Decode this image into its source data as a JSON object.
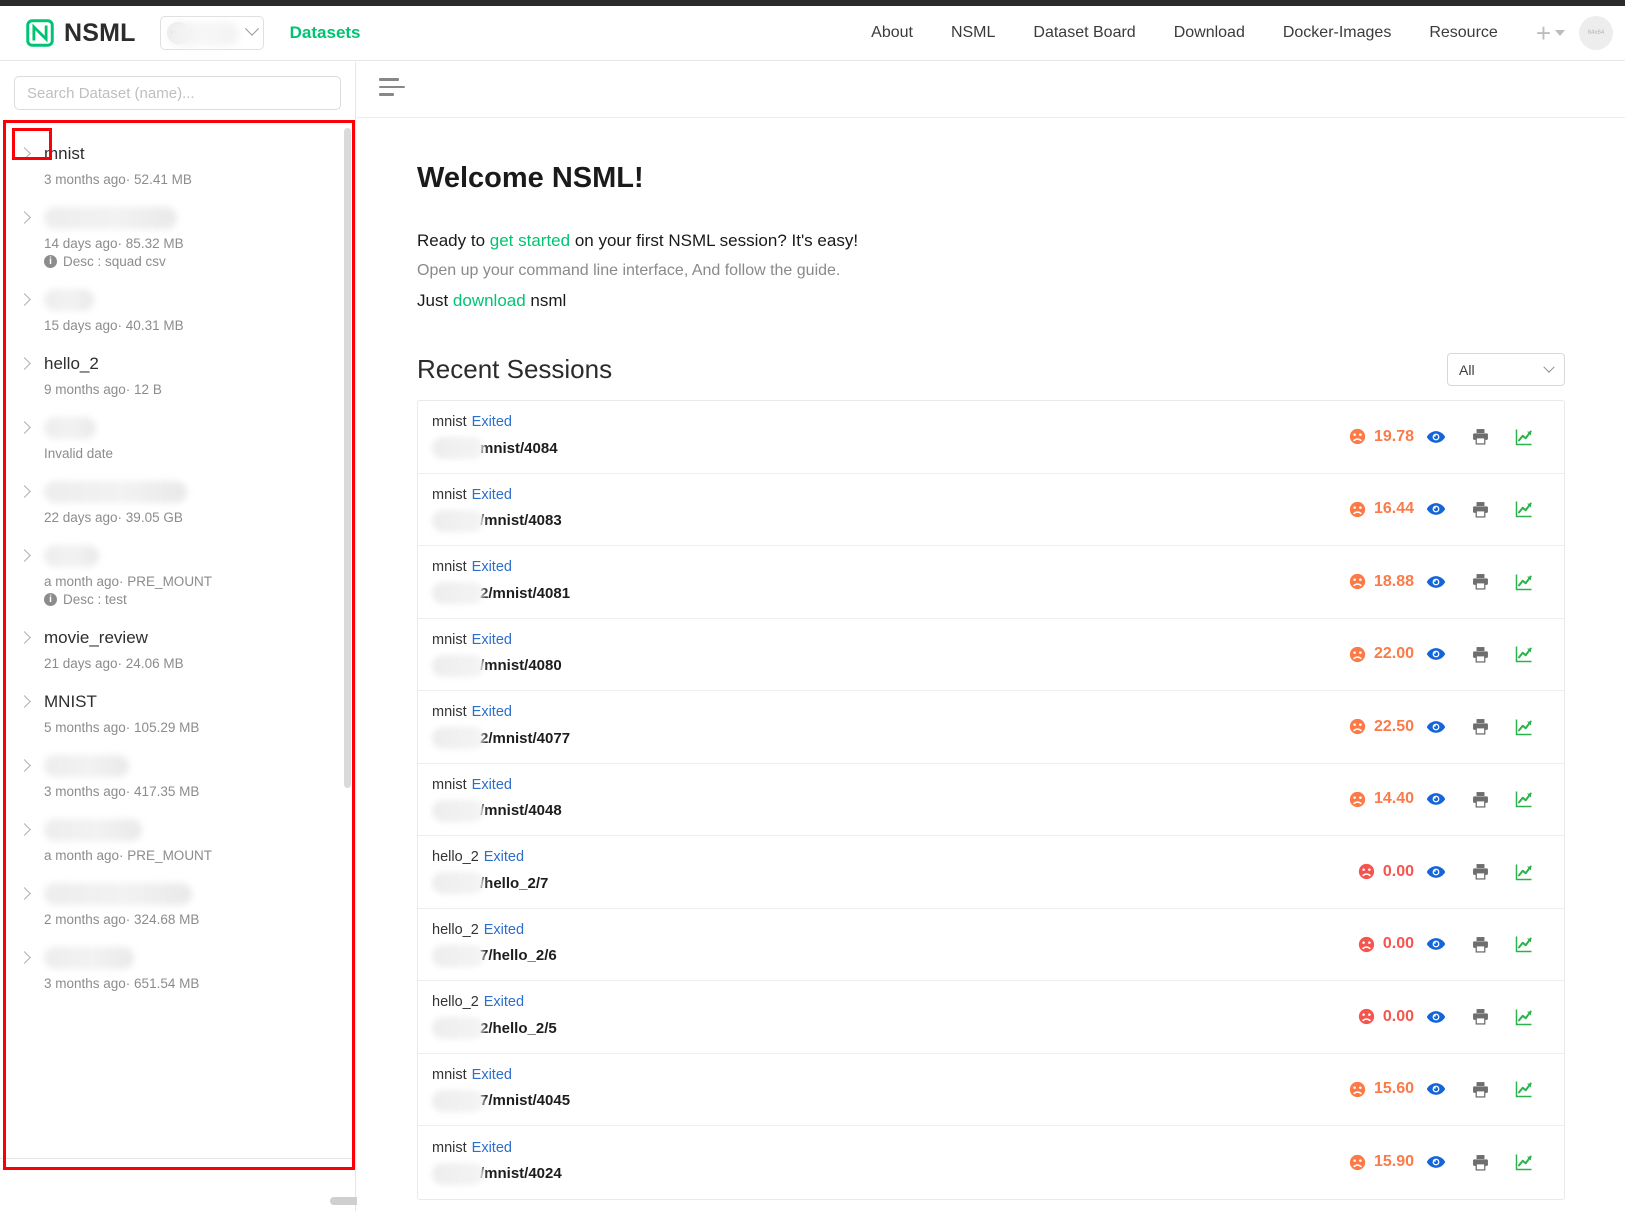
{
  "header": {
    "brand": "NSML",
    "org_avatar_label": "64x64",
    "datasets_link": "Datasets",
    "nav": [
      {
        "label": "About"
      },
      {
        "label": "NSML"
      },
      {
        "label": "Dataset Board"
      },
      {
        "label": "Download"
      },
      {
        "label": "Docker-Images"
      },
      {
        "label": "Resource"
      }
    ],
    "user_avatar_label": "64x64",
    "accent_green": "#00c473"
  },
  "sidebar": {
    "search_placeholder": "Search Dataset (name)...",
    "search_value": "",
    "datasets": [
      {
        "name": "mnist",
        "redacted": false,
        "name_width": 0,
        "meta": "3 months ago· 52.41 MB",
        "desc": ""
      },
      {
        "name": "",
        "redacted": true,
        "name_width": 133,
        "meta": "14 days ago· 85.32 MB",
        "desc": "Desc  : squad csv"
      },
      {
        "name": "",
        "redacted": true,
        "name_width": 50,
        "meta": "15 days ago· 40.31 MB",
        "desc": ""
      },
      {
        "name": "hello_2",
        "redacted": false,
        "name_width": 0,
        "meta": "9 months ago· 12 B",
        "desc": ""
      },
      {
        "name": "",
        "redacted": true,
        "name_width": 52,
        "meta": "Invalid date",
        "desc": ""
      },
      {
        "name": "",
        "redacted": true,
        "name_width": 143,
        "meta": "22 days ago· 39.05 GB",
        "desc": ""
      },
      {
        "name": "",
        "redacted": true,
        "name_width": 55,
        "meta": "a month ago· PRE_MOUNT",
        "desc": "Desc  : test"
      },
      {
        "name": "movie_review",
        "redacted": false,
        "name_width": 0,
        "meta": "21 days ago· 24.06 MB",
        "desc": ""
      },
      {
        "name": "MNIST",
        "redacted": false,
        "name_width": 0,
        "meta": "5 months ago· 105.29 MB",
        "desc": ""
      },
      {
        "name": "",
        "redacted": true,
        "name_width": 85,
        "meta": "3 months ago· 417.35 MB",
        "desc": ""
      },
      {
        "name": "",
        "redacted": true,
        "name_width": 98,
        "meta": "a month ago· PRE_MOUNT",
        "desc": ""
      },
      {
        "name": "",
        "redacted": true,
        "name_width": 148,
        "meta": "2 months ago· 324.68 MB",
        "desc": ""
      },
      {
        "name": "",
        "redacted": true,
        "name_width": 90,
        "meta": "3 months ago· 651.54 MB",
        "desc": ""
      }
    ],
    "highlight_color": "#fb0007"
  },
  "main": {
    "menu_icon": "sort-lines-icon",
    "welcome": {
      "title": "Welcome NSML!",
      "line1_a": "Ready to ",
      "line1_link": "get started",
      "line1_b": " on your first NSML session? It's easy!",
      "line2": "Open up your command line interface, And follow the guide.",
      "line3_a": "Just ",
      "line3_link": "download",
      "line3_b": " nsml"
    },
    "sessions": {
      "title": "Recent Sessions",
      "filter_value": "All",
      "rows": [
        {
          "dataset": "mnist",
          "status": "Exited",
          "path": "mnist/4084",
          "metric": "19.78",
          "metric_color": "#fb7a48",
          "face": "sad"
        },
        {
          "dataset": "mnist",
          "status": "Exited",
          "path": "/mnist/4083",
          "metric": "16.44",
          "metric_color": "#fb7a48",
          "face": "sad"
        },
        {
          "dataset": "mnist",
          "status": "Exited",
          "path": "2/mnist/4081",
          "metric": "18.88",
          "metric_color": "#fb7a48",
          "face": "sad"
        },
        {
          "dataset": "mnist",
          "status": "Exited",
          "path": "/mnist/4080",
          "metric": "22.00",
          "metric_color": "#fb7a48",
          "face": "sad"
        },
        {
          "dataset": "mnist",
          "status": "Exited",
          "path": "2/mnist/4077",
          "metric": "22.50",
          "metric_color": "#fb7a48",
          "face": "sad"
        },
        {
          "dataset": "mnist",
          "status": "Exited",
          "path": "/mnist/4048",
          "metric": "14.40",
          "metric_color": "#fb7a48",
          "face": "sad"
        },
        {
          "dataset": "hello_2",
          "status": "Exited",
          "path": "/hello_2/7",
          "metric": "0.00",
          "metric_color": "#f8544e",
          "face": "sad-red"
        },
        {
          "dataset": "hello_2",
          "status": "Exited",
          "path": "7/hello_2/6",
          "metric": "0.00",
          "metric_color": "#f8544e",
          "face": "sad-red"
        },
        {
          "dataset": "hello_2",
          "status": "Exited",
          "path": "2/hello_2/5",
          "metric": "0.00",
          "metric_color": "#f8544e",
          "face": "sad-red"
        },
        {
          "dataset": "mnist",
          "status": "Exited",
          "path": "7/mnist/4045",
          "metric": "15.60",
          "metric_color": "#fb7a48",
          "face": "sad"
        },
        {
          "dataset": "mnist",
          "status": "Exited",
          "path": "/mnist/4024",
          "metric": "15.90",
          "metric_color": "#fb7a48",
          "face": "sad"
        }
      ],
      "row_icons": [
        "eye-icon",
        "printer-icon",
        "chart-line-icon"
      ]
    }
  }
}
